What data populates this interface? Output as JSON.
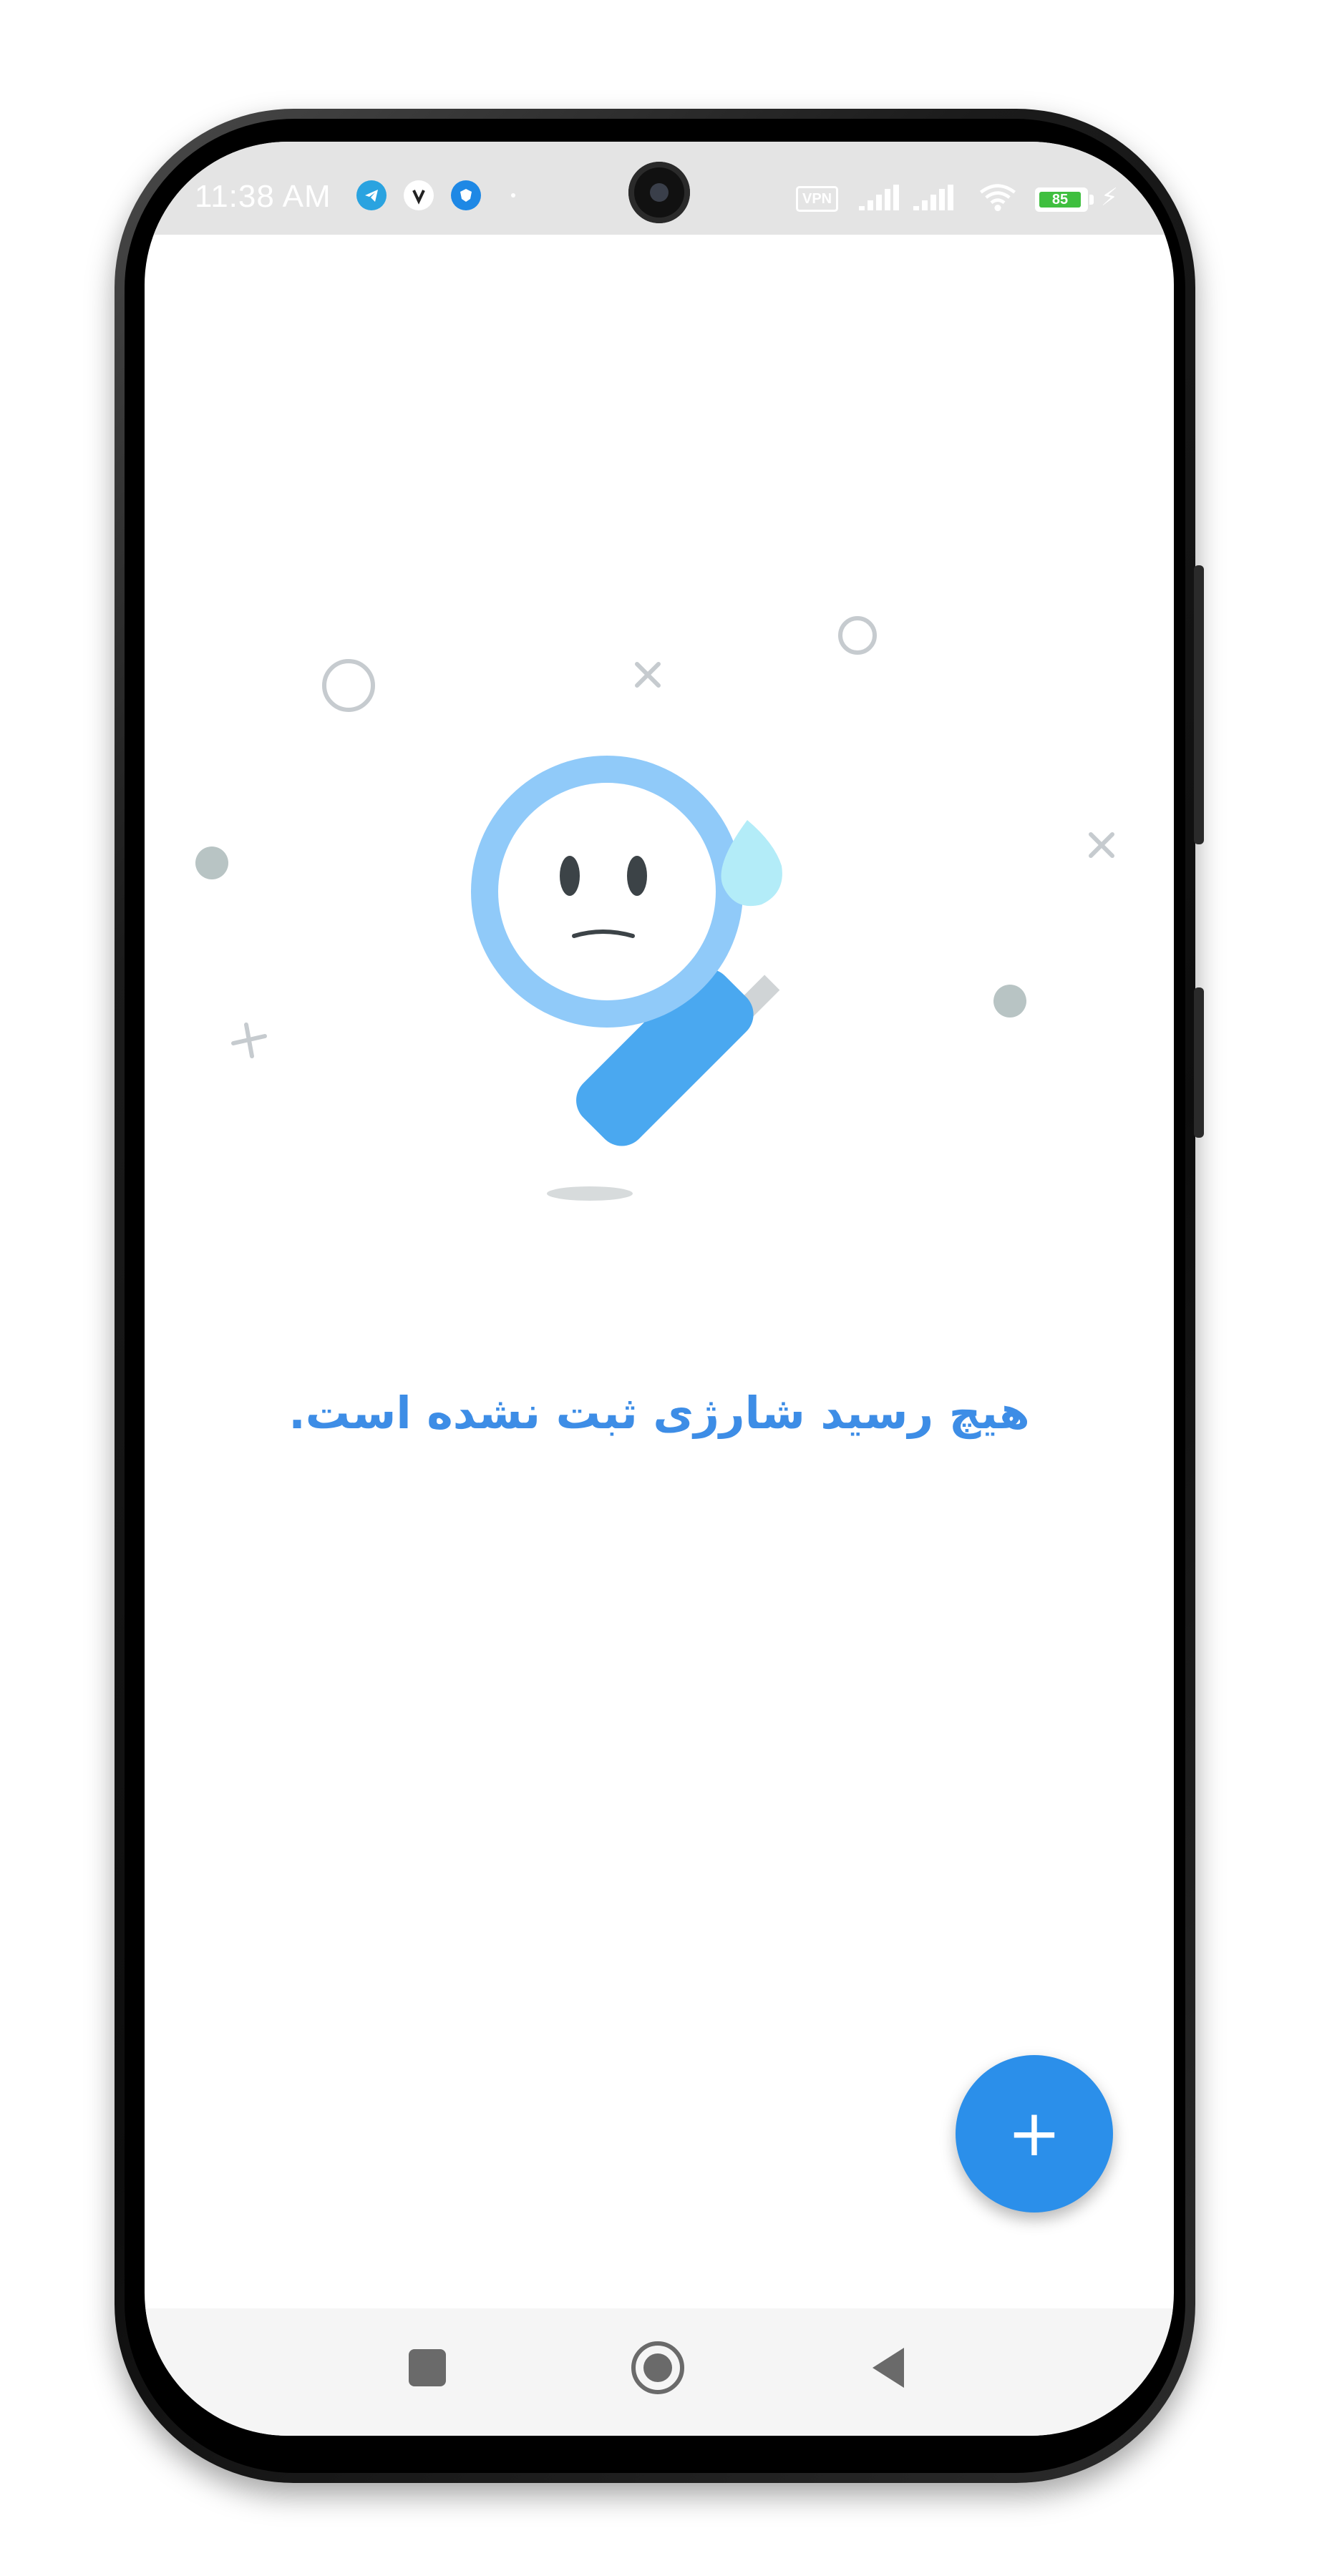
{
  "status_bar": {
    "time": "11:38 AM",
    "vpn_label": "VPN",
    "battery_level": "85",
    "icons": [
      "telegram-icon",
      "v-app-icon",
      "shield-app-icon",
      "signal-icon",
      "signal-icon",
      "wifi-icon",
      "battery-icon",
      "charging-icon"
    ]
  },
  "empty_state": {
    "illustration": "magnifier-sad-face-illustration",
    "message": "هیچ رسید شارژی ثبت نشده است."
  },
  "fab": {
    "symbol": "+",
    "icon": "plus-icon",
    "color": "#2b8fea"
  },
  "nav": {
    "icons": [
      "square-recents-icon",
      "circle-home-icon",
      "triangle-back-icon"
    ]
  },
  "colors": {
    "accent": "#3d8de6",
    "magnifier_ring": "#90caf9",
    "magnifier_handle": "#4aa8f0"
  }
}
